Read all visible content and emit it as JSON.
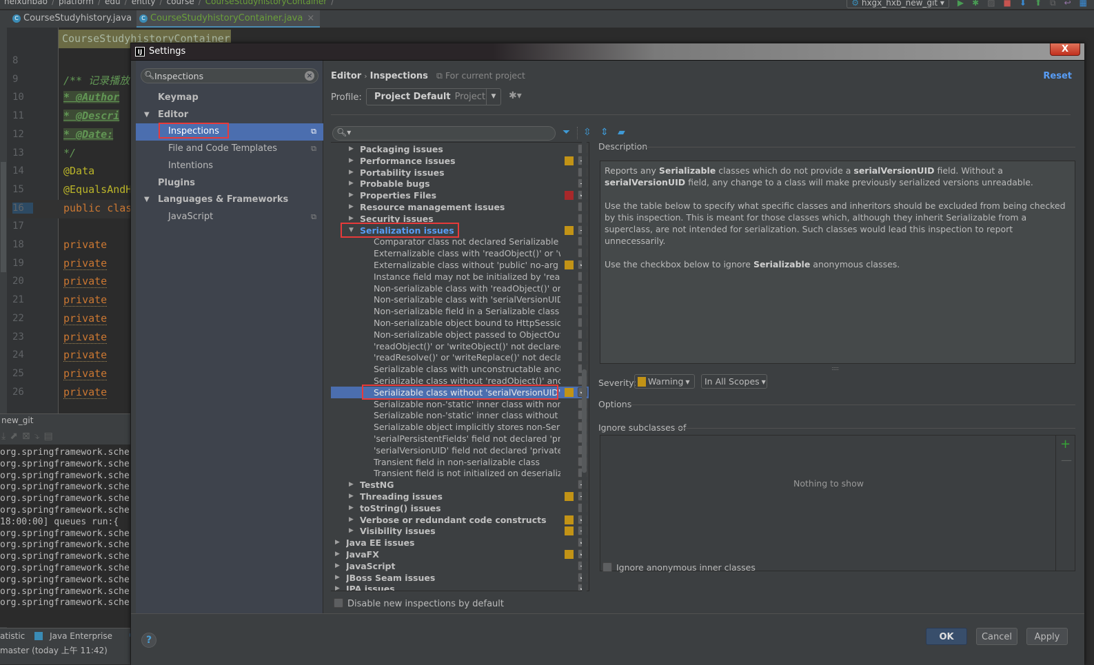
{
  "ide": {
    "breadcrumbs": [
      "heixunbao",
      "platform",
      "edu",
      "entity",
      "course",
      "CourseStudyhistoryContainer"
    ],
    "run_config": "hxgx_hxb_new_git",
    "tabs": [
      {
        "label": "CourseStudyhistory.java",
        "active": false
      },
      {
        "label": "CourseStudyhistoryContainer.java",
        "active": true
      }
    ],
    "class_name_popup": "CourseStudyhistoryContainer",
    "code_lines": [
      {
        "num": "8",
        "text": ""
      },
      {
        "num": "9",
        "text": "/** 记录播放"
      },
      {
        "num": "10",
        "text": " * @Author"
      },
      {
        "num": "11",
        "text": " * @Descri"
      },
      {
        "num": "12",
        "text": " * @Date:"
      },
      {
        "num": "13",
        "text": " */"
      },
      {
        "num": "14",
        "text": "@Data"
      },
      {
        "num": "15",
        "text": "@EqualsAndH"
      },
      {
        "num": "16",
        "text": "public clas"
      },
      {
        "num": "17",
        "text": ""
      },
      {
        "num": "18",
        "text": "    private"
      },
      {
        "num": "19",
        "text": "    private"
      },
      {
        "num": "20",
        "text": "    private"
      },
      {
        "num": "21",
        "text": "    private"
      },
      {
        "num": "22",
        "text": "    private"
      },
      {
        "num": "23",
        "text": "    private"
      },
      {
        "num": "24",
        "text": "    private"
      },
      {
        "num": "25",
        "text": "    private"
      },
      {
        "num": "26",
        "text": "    private"
      }
    ],
    "console_title": "new_git",
    "console_lines": [
      "org.springframework.sche",
      "org.springframework.sche",
      "org.springframework.sche",
      "org.springframework.sche",
      "org.springframework.sche",
      "org.springframework.sche",
      " 18:00:00]  queues run:{",
      "org.springframework.sche",
      "org.springframework.sche",
      "org.springframework.sche",
      "org.springframework.sche",
      "org.springframework.sche",
      "org.springframework.sche",
      "org.springframework.sche"
    ],
    "tool_windows": [
      "atistic",
      "Java Enterprise"
    ],
    "status": "master (today 上午 11:42)"
  },
  "dialog": {
    "title": "Settings",
    "close_label": "X",
    "search": {
      "value": "Inspections",
      "placeholder": ""
    },
    "nav": [
      {
        "label": "Keymap",
        "level": 0,
        "bold": true,
        "expandable": false
      },
      {
        "label": "Editor",
        "level": 0,
        "bold": true,
        "expandable": true
      },
      {
        "label": "Inspections",
        "level": 1,
        "bold": false,
        "selected": true,
        "project_icon": true
      },
      {
        "label": "File and Code Templates",
        "level": 1,
        "bold": false,
        "project_icon": true
      },
      {
        "label": "Intentions",
        "level": 1,
        "bold": false
      },
      {
        "label": "Plugins",
        "level": 0,
        "bold": true,
        "expandable": false
      },
      {
        "label": "Languages & Frameworks",
        "level": 0,
        "bold": true,
        "expandable": true
      },
      {
        "label": "JavaScript",
        "level": 1,
        "bold": false,
        "project_icon": true
      }
    ],
    "breadcrumb": {
      "parent": "Editor",
      "current": "Inspections",
      "scope_note": "For current project"
    },
    "reset_label": "Reset",
    "profile": {
      "label": "Profile:",
      "name": "Project Default",
      "type": "Project"
    },
    "filter": {
      "value": "",
      "placeholder": ""
    },
    "colors": {
      "warning": "#c29316",
      "error": "#a8282a",
      "accent": "#589df6",
      "selection": "#4b6eaf"
    },
    "tree": [
      {
        "label": "Packaging issues",
        "level": 1,
        "group": true,
        "severity": null,
        "state": "off"
      },
      {
        "label": "Performance issues",
        "level": 1,
        "group": true,
        "severity": "warning",
        "state": "partial"
      },
      {
        "label": "Portability issues",
        "level": 1,
        "group": true,
        "severity": null,
        "state": "off"
      },
      {
        "label": "Probable bugs",
        "level": 1,
        "group": true,
        "severity": null,
        "state": "partial"
      },
      {
        "label": "Properties Files",
        "level": 1,
        "group": true,
        "severity": "error",
        "state": "on"
      },
      {
        "label": "Resource management issues",
        "level": 1,
        "group": true,
        "severity": null,
        "state": "off"
      },
      {
        "label": "Security issues",
        "level": 1,
        "group": true,
        "severity": null,
        "state": "off"
      },
      {
        "label": "Serialization issues",
        "level": 1,
        "group": true,
        "expanded": true,
        "highlight": true,
        "severity": "warning",
        "state": "partial"
      },
      {
        "label": "Comparator class not declared Serializable",
        "level": 2,
        "severity": null,
        "state": "off"
      },
      {
        "label": "Externalizable class with 'readObject()' or 'writeObject()'",
        "level": 2,
        "severity": null,
        "state": "off"
      },
      {
        "label": "Externalizable class without 'public' no-arg constructor",
        "level": 2,
        "severity": "warning",
        "state": "on"
      },
      {
        "label": "Instance field may not be initialized by 'readObject()'",
        "level": 2,
        "severity": null,
        "state": "off"
      },
      {
        "label": "Non-serializable class with 'readObject()' or 'writeObject()'",
        "level": 2,
        "severity": null,
        "state": "off"
      },
      {
        "label": "Non-serializable class with 'serialVersionUID'",
        "level": 2,
        "severity": null,
        "state": "off"
      },
      {
        "label": "Non-serializable field in a Serializable class",
        "level": 2,
        "severity": null,
        "state": "off"
      },
      {
        "label": "Non-serializable object bound to HttpSession",
        "level": 2,
        "severity": null,
        "state": "off"
      },
      {
        "label": "Non-serializable object passed to ObjectOutputStream",
        "level": 2,
        "severity": null,
        "state": "off"
      },
      {
        "label": "'readObject()' or 'writeObject()' not declared 'private'",
        "level": 2,
        "severity": null,
        "state": "off"
      },
      {
        "label": "'readResolve()' or 'writeReplace()' not declared 'protected'",
        "level": 2,
        "severity": null,
        "state": "off"
      },
      {
        "label": "Serializable class with unconstructable ancestor",
        "level": 2,
        "severity": null,
        "state": "off"
      },
      {
        "label": "Serializable class without 'readObject()' and 'writeObject()'",
        "level": 2,
        "severity": null,
        "state": "off"
      },
      {
        "label": "Serializable class without 'serialVersionUID'",
        "level": 2,
        "selected": true,
        "highlight": true,
        "severity": "warning",
        "state": "on"
      },
      {
        "label": "Serializable non-'static' inner class with non-Serializable outer class",
        "level": 2,
        "severity": null,
        "state": "off"
      },
      {
        "label": "Serializable non-'static' inner class without 'serialVersionUID'",
        "level": 2,
        "severity": null,
        "state": "off"
      },
      {
        "label": "Serializable object implicitly stores non-Serializable object",
        "level": 2,
        "severity": null,
        "state": "off"
      },
      {
        "label": "'serialPersistentFields' field not declared 'private static final ObjectStreamField[]'",
        "level": 2,
        "severity": null,
        "state": "off"
      },
      {
        "label": "'serialVersionUID' field not declared 'private static final long'",
        "level": 2,
        "severity": null,
        "state": "off"
      },
      {
        "label": "Transient field in non-serializable class",
        "level": 2,
        "severity": null,
        "state": "off"
      },
      {
        "label": "Transient field is not initialized on deserialization",
        "level": 2,
        "severity": null,
        "state": "off"
      },
      {
        "label": "TestNG",
        "level": 1,
        "group": true,
        "severity": null,
        "state": "partial"
      },
      {
        "label": "Threading issues",
        "level": 1,
        "group": true,
        "severity": "warning",
        "state": "partial"
      },
      {
        "label": "toString() issues",
        "level": 1,
        "group": true,
        "severity": null,
        "state": "off"
      },
      {
        "label": "Verbose or redundant code constructs",
        "level": 1,
        "group": true,
        "severity": "warning",
        "state": "on"
      },
      {
        "label": "Visibility issues",
        "level": 1,
        "group": true,
        "severity": "warning",
        "state": "partial"
      },
      {
        "label": "Java EE issues",
        "level": 0,
        "group": true,
        "severity": null,
        "state": "on"
      },
      {
        "label": "JavaFX",
        "level": 0,
        "group": true,
        "severity": "warning",
        "state": "on"
      },
      {
        "label": "JavaScript",
        "level": 0,
        "group": true,
        "severity": null,
        "state": "partial"
      },
      {
        "label": "JBoss Seam issues",
        "level": 0,
        "group": true,
        "severity": null,
        "state": "on"
      },
      {
        "label": "JPA issues",
        "level": 0,
        "group": true,
        "severity": null,
        "state": "on"
      }
    ],
    "disable_new_label": "Disable new inspections by default",
    "description": {
      "title": "Description",
      "paragraphs": [
        [
          {
            "t": "Reports any "
          },
          {
            "t": "Serializable",
            "b": true
          },
          {
            "t": " classes which do not provide a "
          },
          {
            "t": "serialVersionUID",
            "b": true
          },
          {
            "t": " field. Without a "
          },
          {
            "t": "serialVersionUID",
            "b": true
          },
          {
            "t": " field, any change to a class will make previously serialized versions unreadable."
          }
        ],
        [
          {
            "t": "Use the table below to specify what specific classes and inheritors should be excluded from being checked by this inspection. This is meant for those classes which, although they inherit Serializable from a superclass, are not intended for serialization. Such classes would lead this inspection to report unnecessarily."
          }
        ],
        [
          {
            "t": "Use the checkbox below to ignore "
          },
          {
            "t": "Serializable",
            "b": true
          },
          {
            "t": " anonymous classes."
          }
        ]
      ]
    },
    "severity": {
      "label": "Severity:",
      "value": "Warning",
      "scope": "In All Scopes"
    },
    "options_title": "Options",
    "ignore_subclasses_title": "Ignore subclasses of",
    "table_empty": "Nothing to show",
    "ignore_anon_label": "Ignore anonymous inner classes",
    "buttons": {
      "ok": "OK",
      "cancel": "Cancel",
      "apply": "Apply",
      "help": "?"
    }
  }
}
